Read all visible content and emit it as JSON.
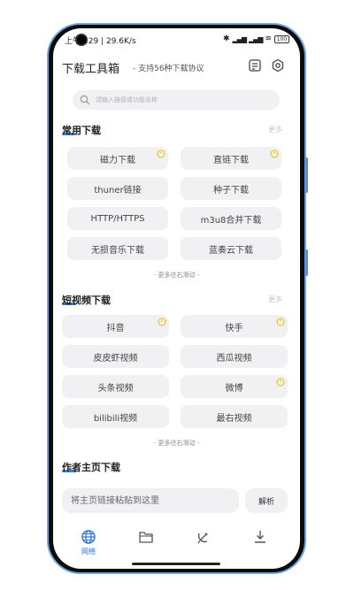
{
  "status_bar": {
    "time_speed": "上午9:29 | 29.6K/s",
    "battery": "100"
  },
  "header": {
    "title": "下载工具箱",
    "subtitle": "- 支持56种下载协议",
    "icons": [
      "notes-icon",
      "settings-icon"
    ]
  },
  "search": {
    "placeholder": "请输入链接或功能名称"
  },
  "sections": {
    "common": {
      "title": "常用下载",
      "more": "更多",
      "buttons": [
        "磁力下载",
        "直链下载",
        "thuner链接",
        "种子下载",
        "HTTP/HTTPS",
        "m3u8合并下载",
        "无损音乐下载",
        "蓝奏云下载"
      ],
      "hint": "- 更多往右滑动 -"
    },
    "short_video": {
      "title": "短视频下载",
      "more": "更多",
      "buttons": [
        "抖音",
        "快手",
        "皮皮虾视频",
        "西瓜视频",
        "头条视频",
        "微博",
        "bilibili视频",
        "最右视频"
      ],
      "hint": "- 更多往右滑动 -"
    },
    "author": {
      "title": "作者主页下载",
      "paste_placeholder": "将主页链接粘贴到这里",
      "parse_label": "解析"
    }
  },
  "bottom_nav": {
    "items": [
      {
        "icon": "globe-icon",
        "label": "网络",
        "active": true
      },
      {
        "icon": "folder-icon",
        "label": "",
        "active": false
      },
      {
        "icon": "satellite-dish-icon",
        "label": "",
        "active": false
      },
      {
        "icon": "download-icon",
        "label": "",
        "active": false
      }
    ]
  },
  "colors": {
    "accent": "#2e73d9",
    "button_bg": "#f1f1f3",
    "badge": "#f5c542",
    "frame_blue": "#6fa6dd"
  }
}
